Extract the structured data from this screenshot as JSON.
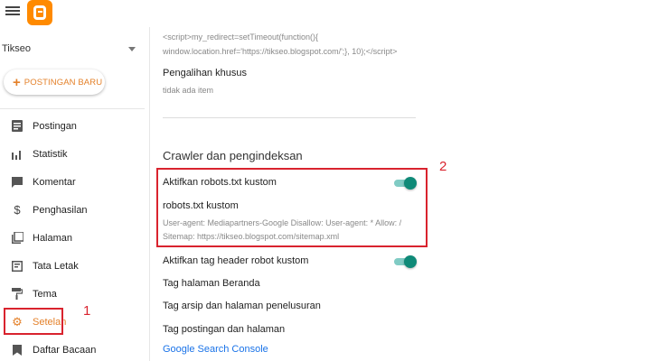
{
  "app": {
    "logo_name": "blogger-logo"
  },
  "blog": {
    "name": "Tikseo"
  },
  "sidebar": {
    "new_post_label": "POSTINGAN BARU",
    "items": [
      {
        "label": "Postingan",
        "icon": "document-icon"
      },
      {
        "label": "Statistik",
        "icon": "bar-chart-icon"
      },
      {
        "label": "Komentar",
        "icon": "comment-icon"
      },
      {
        "label": "Penghasilan",
        "icon": "dollar-icon"
      },
      {
        "label": "Halaman",
        "icon": "pages-icon"
      },
      {
        "label": "Tata Letak",
        "icon": "layout-icon"
      },
      {
        "label": "Tema",
        "icon": "paint-roller-icon"
      },
      {
        "label": "Setelan",
        "icon": "gear-icon",
        "active": true
      },
      {
        "label": "Daftar Bacaan",
        "icon": "bookmark-icon"
      }
    ]
  },
  "main": {
    "code_line1": "<script>my_redirect=setTimeout(function(){",
    "code_line2": "window.location.href='https://tikseo.blogspot.com/';}, 10);</script>",
    "custom_redirect_label": "Pengalihan khusus",
    "custom_redirect_value": "tidak ada item",
    "crawler_title": "Crawler dan pengindeksan",
    "enable_robots_label": "Aktifkan robots.txt kustom",
    "enable_robots_on": true,
    "robots_label": "robots.txt kustom",
    "robots_value": "User-agent: Mediapartners-Google Disallow: User-agent: * Allow: /",
    "robots_value2": "Sitemap: https://tikseo.blogspot.com/sitemap.xml",
    "enable_header_tags_label": "Aktifkan tag header robot kustom",
    "enable_header_tags_on": true,
    "home_tags_label": "Tag halaman Beranda",
    "archive_tags_label": "Tag arsip dan halaman penelusuran",
    "post_tags_label": "Tag postingan dan halaman",
    "search_console_link": "Google Search Console"
  },
  "annotations": {
    "num1": "1",
    "num2": "2"
  },
  "colors": {
    "accent": "#e4812a",
    "annotation": "#d9232e",
    "toggle": "#0f8a78",
    "link": "#1a73e8"
  }
}
